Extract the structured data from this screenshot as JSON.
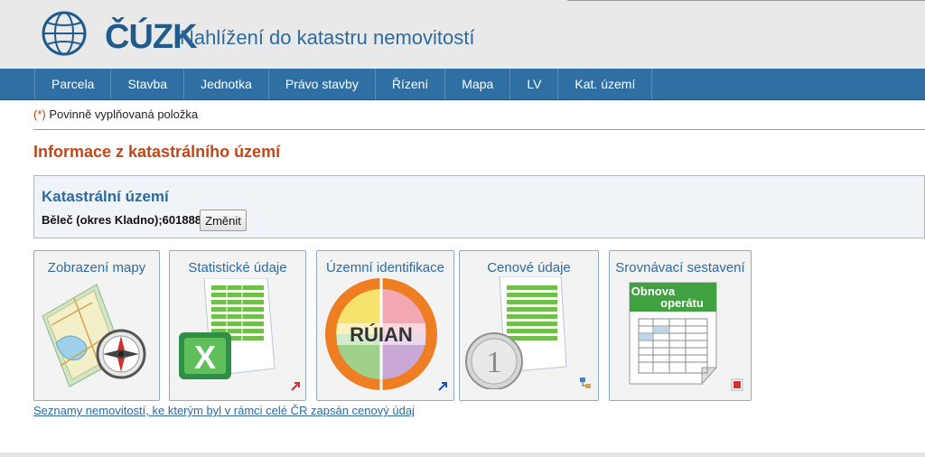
{
  "header": {
    "logo_text": "ČÚZK",
    "site_title": "Nahlížení do katastru nemovitostí"
  },
  "nav": {
    "items": [
      "Parcela",
      "Stavba",
      "Jednotka",
      "Právo stavby",
      "Řízení",
      "Mapa",
      "LV",
      "Kat. území"
    ]
  },
  "form": {
    "required_star": "(*)",
    "required_text": "Povinně vyplňovaná položka"
  },
  "page": {
    "heading": "Informace z katastrálního území"
  },
  "cadastral_area": {
    "title": "Katastrální území",
    "value": "Běleč (okres Kladno);601888",
    "change_label": "Změnit"
  },
  "tiles": [
    {
      "label": "Zobrazení mapy",
      "icon": "map-compass-icon"
    },
    {
      "label": "Statistické údaje",
      "icon": "excel-spreadsheet-icon"
    },
    {
      "label": "Územní identifikace",
      "icon": "ruian-logo-icon",
      "logo_text": "RÚIAN"
    },
    {
      "label": "Cenové údaje",
      "icon": "coin-spreadsheet-icon"
    },
    {
      "label": "Srovnávací sestavení",
      "icon": "document-table-icon",
      "banner_line1": "Obnova",
      "banner_line2": "operátu"
    }
  ],
  "bottom_link": "Seznamy nemovitostí, ke kterým byl v rámci celé ČR zapsán cenový údaj",
  "colors": {
    "brand_blue": "#2f6fa3",
    "heading_orange": "#c0471b",
    "link_blue": "#2d6a9f"
  }
}
